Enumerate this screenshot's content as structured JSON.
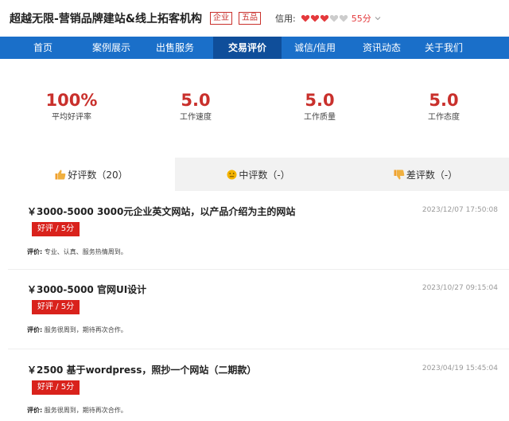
{
  "shop": {
    "name": "超越无限-营销品牌建站&线上拓客机构",
    "tags": [
      "企业",
      "五品"
    ],
    "credit_label": "信用:",
    "hearts_filled": 3,
    "hearts_total": 5,
    "credit_score": "55分"
  },
  "nav": {
    "items": [
      "首页",
      "案例展示",
      "出售服务",
      "交易评价",
      "诚信/信用",
      "资讯动态",
      "关于我们"
    ],
    "active_index": 3
  },
  "stats": [
    {
      "value": "100%",
      "label": "平均好评率"
    },
    {
      "value": "5.0",
      "label": "工作速度"
    },
    {
      "value": "5.0",
      "label": "工作质量"
    },
    {
      "value": "5.0",
      "label": "工作态度"
    }
  ],
  "tabs": [
    {
      "label": "好评数（20）",
      "icon": "thumbs-up-icon"
    },
    {
      "label": "中评数（-）",
      "icon": "neutral-face-icon"
    },
    {
      "label": "差评数（-）",
      "icon": "thumbs-down-icon"
    }
  ],
  "reviews": [
    {
      "title": "￥3000-5000 3000元企业英文网站，以产品介绍为主的网站",
      "date": "2023/12/07 17:50:08",
      "badge": "好评 / 5分",
      "comment_label": "评价:",
      "comment": "专业、认真、服务热情周到。"
    },
    {
      "title": "￥3000-5000 官网UI设计",
      "date": "2023/10/27 09:15:04",
      "badge": "好评 / 5分",
      "comment_label": "评价:",
      "comment": "服务很周到，期待再次合作。"
    },
    {
      "title": "￥2500 基于wordpress，照抄一个网站（二期款）",
      "date": "2023/04/19 15:45:04",
      "badge": "好评 / 5分",
      "comment_label": "评价:",
      "comment": "服务很周到，期待再次合作。"
    }
  ],
  "colors": {
    "nav_bg": "#1a6fc9",
    "nav_active": "#0f4e9a",
    "accent_red": "#c9302c",
    "heart_filled": "#e4393c",
    "heart_empty": "#cccccc"
  }
}
